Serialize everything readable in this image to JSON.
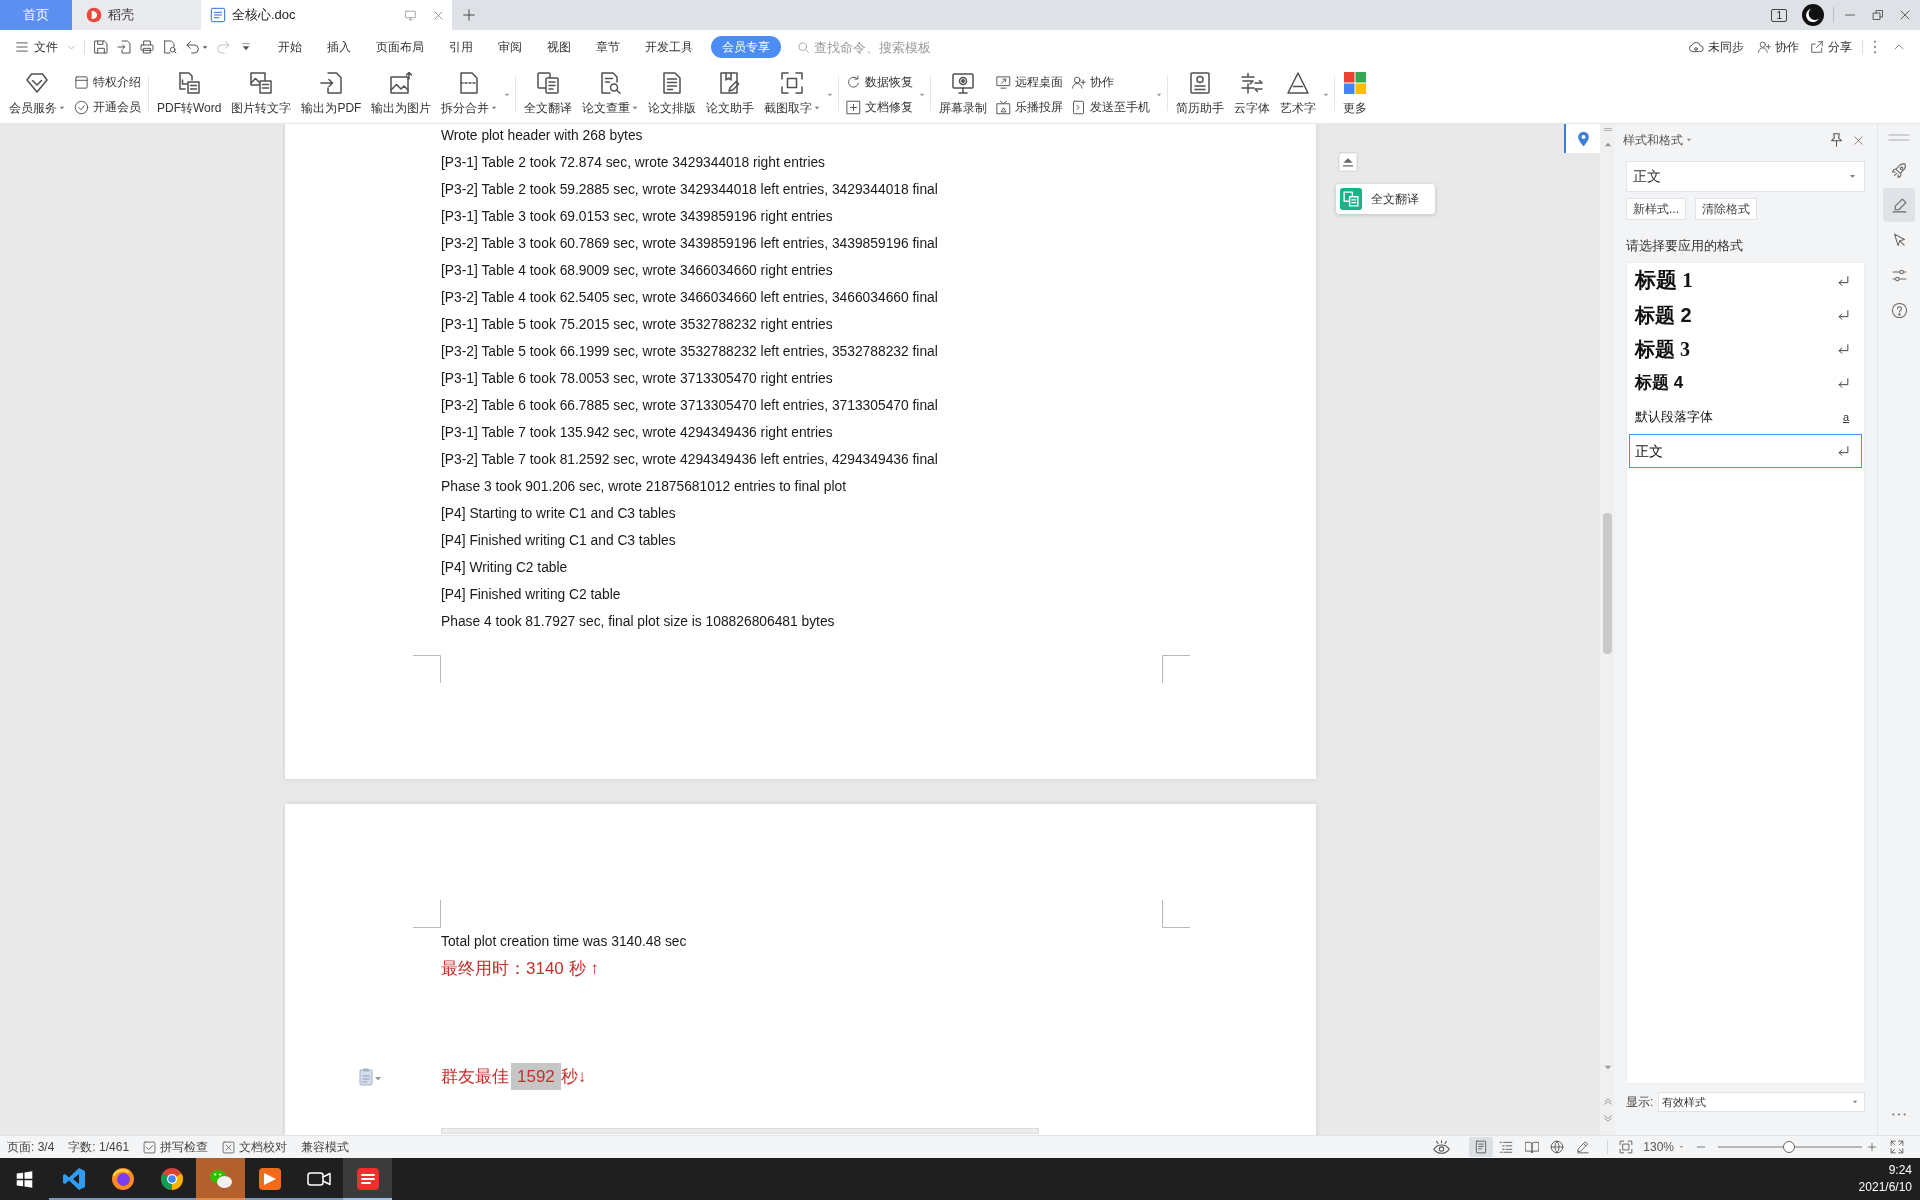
{
  "title_bar": {
    "tabs": [
      {
        "label": "首页",
        "kind": "home",
        "selected": false
      },
      {
        "label": "稻壳",
        "kind": "store",
        "selected": false
      },
      {
        "label": "全核心.doc",
        "kind": "document",
        "selected": true
      }
    ],
    "window_count": "1"
  },
  "menu_bar": {
    "file": "文件",
    "quick_access": [
      {
        "disabled": false
      },
      {
        "disabled": false
      },
      {
        "disabled": false
      },
      {
        "disabled": false
      },
      {
        "disabled": false
      },
      {
        "disabled": true
      },
      {
        "disabled": false
      }
    ],
    "tabs": [
      {
        "label": "开始",
        "selected": false
      },
      {
        "label": "插入",
        "selected": false
      },
      {
        "label": "页面布局",
        "selected": false
      },
      {
        "label": "引用",
        "selected": false
      },
      {
        "label": "审阅",
        "selected": false
      },
      {
        "label": "视图",
        "selected": false
      },
      {
        "label": "章节",
        "selected": false
      },
      {
        "label": "开发工具",
        "selected": false
      },
      {
        "label": "会员专享",
        "selected": true
      }
    ],
    "search": {
      "placeholder": "查找命令、搜索模板"
    },
    "actions": [
      {
        "label": "未同步"
      },
      {
        "label": "协作"
      },
      {
        "label": "分享"
      }
    ]
  },
  "ribbon": {
    "groups": [
      {
        "items": [
          {
            "kind": "large",
            "label": "会员服务",
            "dropdown": true
          },
          {
            "kind": "stack",
            "items": [
              {
                "label": "特权介绍"
              },
              {
                "label": "开通会员"
              }
            ]
          }
        ],
        "more": false
      },
      {
        "items": [
          {
            "kind": "large",
            "label": "PDF转Word",
            "dropdown": false
          },
          {
            "kind": "large",
            "label": "图片转文字",
            "dropdown": false
          },
          {
            "kind": "large",
            "label": "输出为PDF",
            "dropdown": false
          },
          {
            "kind": "large",
            "label": "输出为图片",
            "dropdown": false
          },
          {
            "kind": "large",
            "label": "拆分合并",
            "dropdown": true
          }
        ],
        "more": true
      },
      {
        "items": [
          {
            "kind": "large",
            "label": "全文翻译",
            "dropdown": false
          },
          {
            "kind": "large",
            "label": "论文查重",
            "dropdown": true
          },
          {
            "kind": "large",
            "label": "论文排版",
            "dropdown": false
          },
          {
            "kind": "large",
            "label": "论文助手",
            "dropdown": false
          },
          {
            "kind": "large",
            "label": "截图取字",
            "dropdown": true
          }
        ],
        "more": true
      },
      {
        "items": [
          {
            "kind": "stack",
            "items": [
              {
                "label": "数据恢复"
              },
              {
                "label": "文档修复"
              }
            ]
          }
        ],
        "more": true
      },
      {
        "items": [
          {
            "kind": "large",
            "label": "屏幕录制",
            "dropdown": false
          },
          {
            "kind": "stack",
            "items": [
              {
                "label": "远程桌面"
              },
              {
                "label": "乐播投屏"
              }
            ]
          },
          {
            "kind": "stack",
            "items": [
              {
                "label": "协作"
              },
              {
                "label": "发送至手机"
              }
            ]
          }
        ],
        "more": true
      },
      {
        "items": [
          {
            "kind": "large",
            "label": "简历助手",
            "dropdown": false
          },
          {
            "kind": "large",
            "label": "云字体",
            "dropdown": false
          },
          {
            "kind": "large",
            "label": "艺术字",
            "dropdown": false
          }
        ],
        "more": true
      },
      {
        "items": [
          {
            "kind": "large",
            "label": "更多",
            "dropdown": false
          }
        ],
        "more": false
      }
    ]
  },
  "document": {
    "pages": [
      {
        "lines": [
          {
            "kind": "plain",
            "text": "Wrote plot header with 268 bytes"
          },
          {
            "kind": "plain",
            "text": "[P3-1] Table 2 took 72.874 sec, wrote 3429344018 right entries"
          },
          {
            "kind": "plain",
            "text": "[P3-2] Table 2 took 59.2885 sec, wrote 3429344018 left entries, 3429344018 final"
          },
          {
            "kind": "plain",
            "text": "[P3-1] Table 3 took 69.0153 sec, wrote 3439859196 right entries"
          },
          {
            "kind": "plain",
            "text": "[P3-2] Table 3 took 60.7869 sec, wrote 3439859196 left entries, 3439859196 final"
          },
          {
            "kind": "plain",
            "text": "[P3-1] Table 4 took 68.9009 sec, wrote 3466034660 right entries"
          },
          {
            "kind": "plain",
            "text": "[P3-2] Table 4 took 62.5405 sec, wrote 3466034660 left entries, 3466034660 final"
          },
          {
            "kind": "plain",
            "text": "[P3-1] Table 5 took 75.2015 sec, wrote 3532788232 right entries"
          },
          {
            "kind": "plain",
            "text": "[P3-2] Table 5 took 66.1999 sec, wrote 3532788232 left entries, 3532788232 final"
          },
          {
            "kind": "plain",
            "text": "[P3-1] Table 6 took 78.0053 sec, wrote 3713305470 right entries"
          },
          {
            "kind": "plain",
            "text": "[P3-2] Table 6 took 66.7885 sec, wrote 3713305470 left entries, 3713305470 final"
          },
          {
            "kind": "plain",
            "text": "[P3-1] Table 7 took 135.942 sec, wrote 4294349436 right entries"
          },
          {
            "kind": "plain",
            "text": "[P3-2] Table 7 took 81.2592 sec, wrote 4294349436 left entries, 4294349436 final"
          },
          {
            "kind": "plain",
            "text": "Phase 3 took 901.206 sec, wrote 21875681012 entries to final plot"
          },
          {
            "kind": "plain",
            "text": "[P4] Starting to write C1 and C3 tables"
          },
          {
            "kind": "plain",
            "text": "[P4] Finished writing C1 and C3 tables"
          },
          {
            "kind": "plain",
            "text": "[P4] Writing C2 table"
          },
          {
            "kind": "plain",
            "text": "[P4] Finished writing C2 table"
          },
          {
            "kind": "plain",
            "text": "Phase 4 took 81.7927 sec, final plot size is 108826806481 bytes"
          }
        ]
      },
      {
        "lines": [
          {
            "kind": "plain",
            "text": "Total plot creation time was 3140.48 sec"
          },
          {
            "kind": "note",
            "paste_options": false,
            "segments": [
              {
                "text": "最终用时：3140 秒 ↑",
                "highlight": false
              }
            ]
          },
          {
            "kind": "note",
            "paste_options": true,
            "segments": [
              {
                "text": "群友最佳",
                "highlight": false
              },
              {
                "text": "1592",
                "highlight": true
              },
              {
                "text": "秒↓",
                "highlight": false
              }
            ]
          }
        ]
      }
    ],
    "translate_button": "全文翻译"
  },
  "styles_panel": {
    "title": "样式和格式",
    "current_style": "正文",
    "buttons": [
      "新样式...",
      "清除格式"
    ],
    "prompt": "请选择要应用的格式",
    "styles": [
      {
        "label": "标题 1",
        "kind": "heading1",
        "selected": false
      },
      {
        "label": "标题 2",
        "kind": "heading2",
        "selected": false
      },
      {
        "label": "标题 3",
        "kind": "heading3",
        "selected": false
      },
      {
        "label": "标题 4",
        "kind": "heading4",
        "selected": false
      },
      {
        "label": "默认段落字体",
        "kind": "character",
        "marker": "a",
        "selected": false
      },
      {
        "label": "正文",
        "kind": "paragraph",
        "selected": true
      }
    ],
    "show_label": "显示:",
    "show_value": "有效样式"
  },
  "side_toolbar": {
    "tools": [
      {
        "selected": false
      },
      {
        "selected": true
      },
      {
        "selected": false
      },
      {
        "selected": false
      },
      {
        "selected": false
      }
    ]
  },
  "status_bar": {
    "items": [
      {
        "kind": "text",
        "label": "页面: 3/4"
      },
      {
        "kind": "text",
        "label": "字数: 1/461"
      },
      {
        "kind": "spellcheck",
        "label": "拼写检查"
      },
      {
        "kind": "proofread",
        "label": "文档校对"
      },
      {
        "kind": "text",
        "label": "兼容模式"
      }
    ],
    "view_modes": [
      {
        "selected": true
      },
      {
        "selected": false
      },
      {
        "selected": false
      },
      {
        "selected": false
      },
      {
        "selected": false
      }
    ],
    "zoom": {
      "value": "130%",
      "level": 0.49
    }
  },
  "taskbar": {
    "apps": [
      {
        "running": true,
        "flashing": false,
        "selected": false
      },
      {
        "running": true,
        "flashing": false,
        "selected": false
      },
      {
        "running": true,
        "flashing": false,
        "selected": false
      },
      {
        "running": true,
        "flashing": true,
        "selected": false
      },
      {
        "running": true,
        "flashing": false,
        "selected": false
      },
      {
        "running": true,
        "flashing": false,
        "selected": false
      },
      {
        "running": true,
        "flashing": false,
        "selected": true
      }
    ],
    "time": "9:24",
    "date": "2021/6/10"
  }
}
